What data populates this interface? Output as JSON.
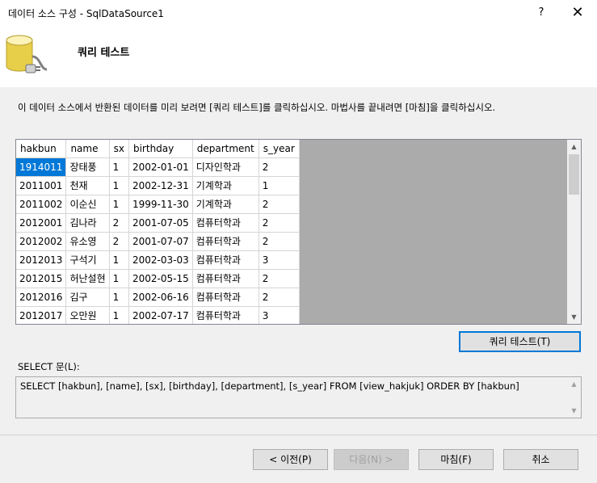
{
  "window": {
    "title": "데이터 소스 구성 - SqlDataSource1",
    "help_glyph": "?",
    "close_glyph": "✕"
  },
  "header": {
    "title": "쿼리 테스트",
    "icon": "database-icon"
  },
  "description": "이 데이터 소스에서 반환된 데이터를 미리 보려면 [쿼리 테스트]를 클릭하십시오. 마법사를 끝내려면 [마침]을 클릭하십시오.",
  "grid": {
    "columns": [
      "hakbun",
      "name",
      "sx",
      "birthday",
      "department",
      "s_year"
    ],
    "rows": [
      [
        "1914011",
        "장태풍",
        "1",
        "2002-01-01",
        "디자인학과",
        "2"
      ],
      [
        "2011001",
        "천재",
        "1",
        "2002-12-31",
        "기계학과",
        "1"
      ],
      [
        "2011002",
        "이순신",
        "1",
        "1999-11-30",
        "기계학과",
        "2"
      ],
      [
        "2012001",
        "김나라",
        "2",
        "2001-07-05",
        "컴퓨터학과",
        "2"
      ],
      [
        "2012002",
        "유소영",
        "2",
        "2001-07-07",
        "컴퓨터학과",
        "2"
      ],
      [
        "2012013",
        "구석기",
        "1",
        "2002-03-03",
        "컴퓨터학과",
        "3"
      ],
      [
        "2012015",
        "허난설현",
        "1",
        "2002-05-15",
        "컴퓨터학과",
        "2"
      ],
      [
        "2012016",
        "김구",
        "1",
        "2002-06-16",
        "컴퓨터학과",
        "2"
      ],
      [
        "2012017",
        "오만원",
        "1",
        "2002-07-17",
        "컴퓨터학과",
        "3"
      ]
    ],
    "selected_cell": "1914011"
  },
  "buttons": {
    "test_query": "쿼리 테스트(T)",
    "prev": "< 이전(P)",
    "next": "다음(N) >",
    "finish": "마침(F)",
    "cancel": "취소"
  },
  "select_label": "SELECT 문(L):",
  "select_statement": "SELECT [hakbun], [name], [sx], [birthday], [department], [s_year] FROM [view_hakjuk] ORDER BY [hakbun]"
}
